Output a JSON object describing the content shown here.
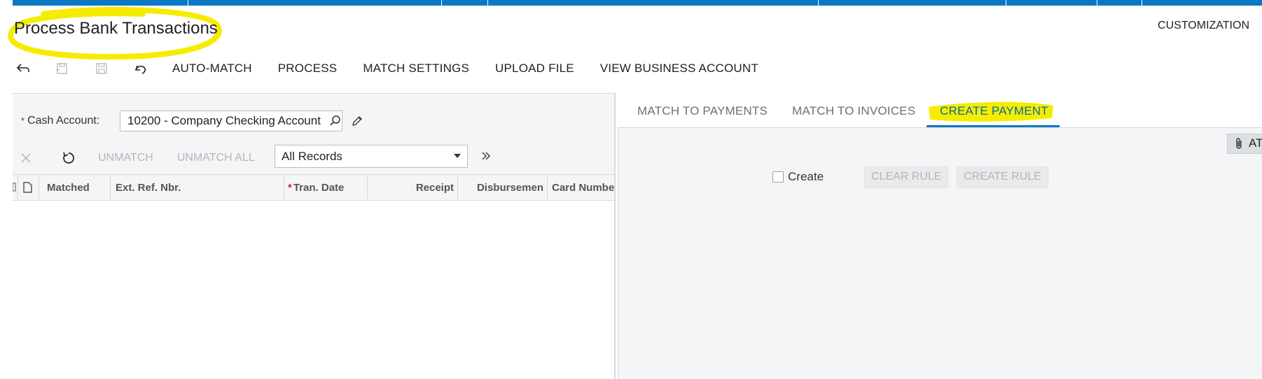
{
  "header": {
    "title": "Process Bank Transactions",
    "customization_label": "CUSTOMIZATION",
    "highlight_color": "#f5ec00",
    "bar_color": "#0a78c2"
  },
  "toolbar": {
    "icons": [
      "back-icon",
      "save-close-icon",
      "save-icon",
      "undo-icon"
    ],
    "buttons": [
      "AUTO-MATCH",
      "PROCESS",
      "MATCH SETTINGS",
      "UPLOAD FILE",
      "VIEW BUSINESS ACCOUNT"
    ]
  },
  "left": {
    "cash_account_label": "Cash Account:",
    "cash_account_value": "10200 - Company Checking Account",
    "sub_toolbar": {
      "unmatch_label": "UNMATCH",
      "unmatch_all_label": "UNMATCH ALL",
      "filter_value": "All Records"
    },
    "grid_columns": [
      "Matched",
      "Ext. Ref. Nbr.",
      "Tran. Date",
      "Receipt",
      "Disbursemen",
      "Card Number"
    ]
  },
  "right": {
    "tabs": [
      "MATCH TO PAYMENTS",
      "MATCH TO INVOICES",
      "CREATE PAYMENT"
    ],
    "active_tab": "CREATE PAYMENT",
    "attach_label": "AT",
    "create_checkbox_label": "Create",
    "create_checked": false,
    "clear_rule_label": "CLEAR RULE",
    "create_rule_label": "CREATE RULE"
  }
}
